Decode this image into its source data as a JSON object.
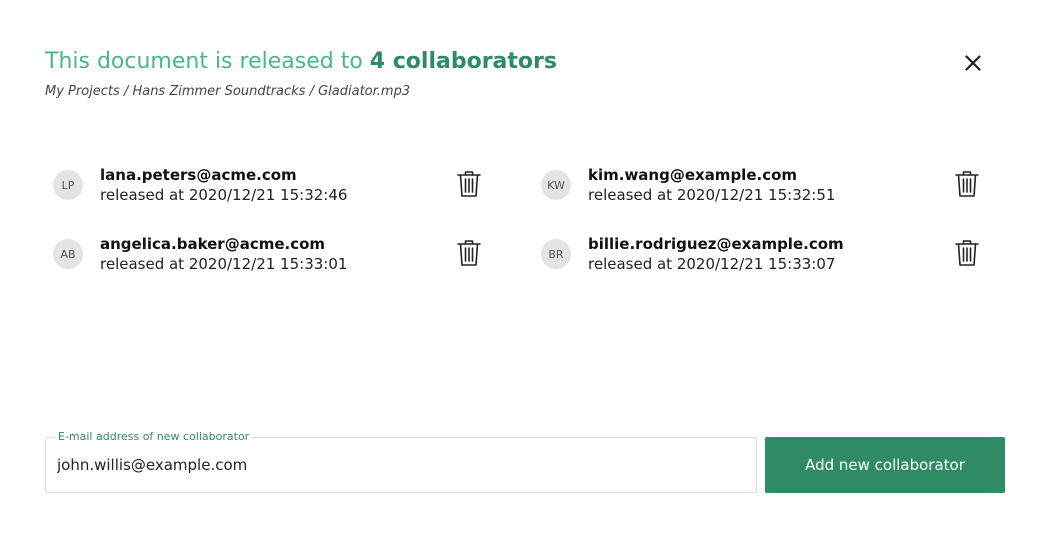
{
  "header": {
    "title_prefix": "This document is released to ",
    "title_count": "4 collaborators",
    "breadcrumb": "My Projects / Hans Zimmer Soundtracks / Gladiator.mp3",
    "close_icon": "close-icon"
  },
  "collaborators": [
    {
      "initials": "LP",
      "email": "lana.peters@acme.com",
      "released": "released at 2020/12/21 15:32:46"
    },
    {
      "initials": "KW",
      "email": "kim.wang@example.com",
      "released": "released at 2020/12/21 15:32:51"
    },
    {
      "initials": "AB",
      "email": "angelica.baker@acme.com",
      "released": "released at 2020/12/21 15:33:01"
    },
    {
      "initials": "BR",
      "email": "billie.rodriguez@example.com",
      "released": "released at 2020/12/21 15:33:07"
    }
  ],
  "new_collaborator": {
    "label": "E-mail address of new collaborator",
    "value": "john.willis@example.com",
    "button_label": "Add new collaborator"
  },
  "colors": {
    "accent": "#2e8b66",
    "title_light": "#4bb58e"
  }
}
